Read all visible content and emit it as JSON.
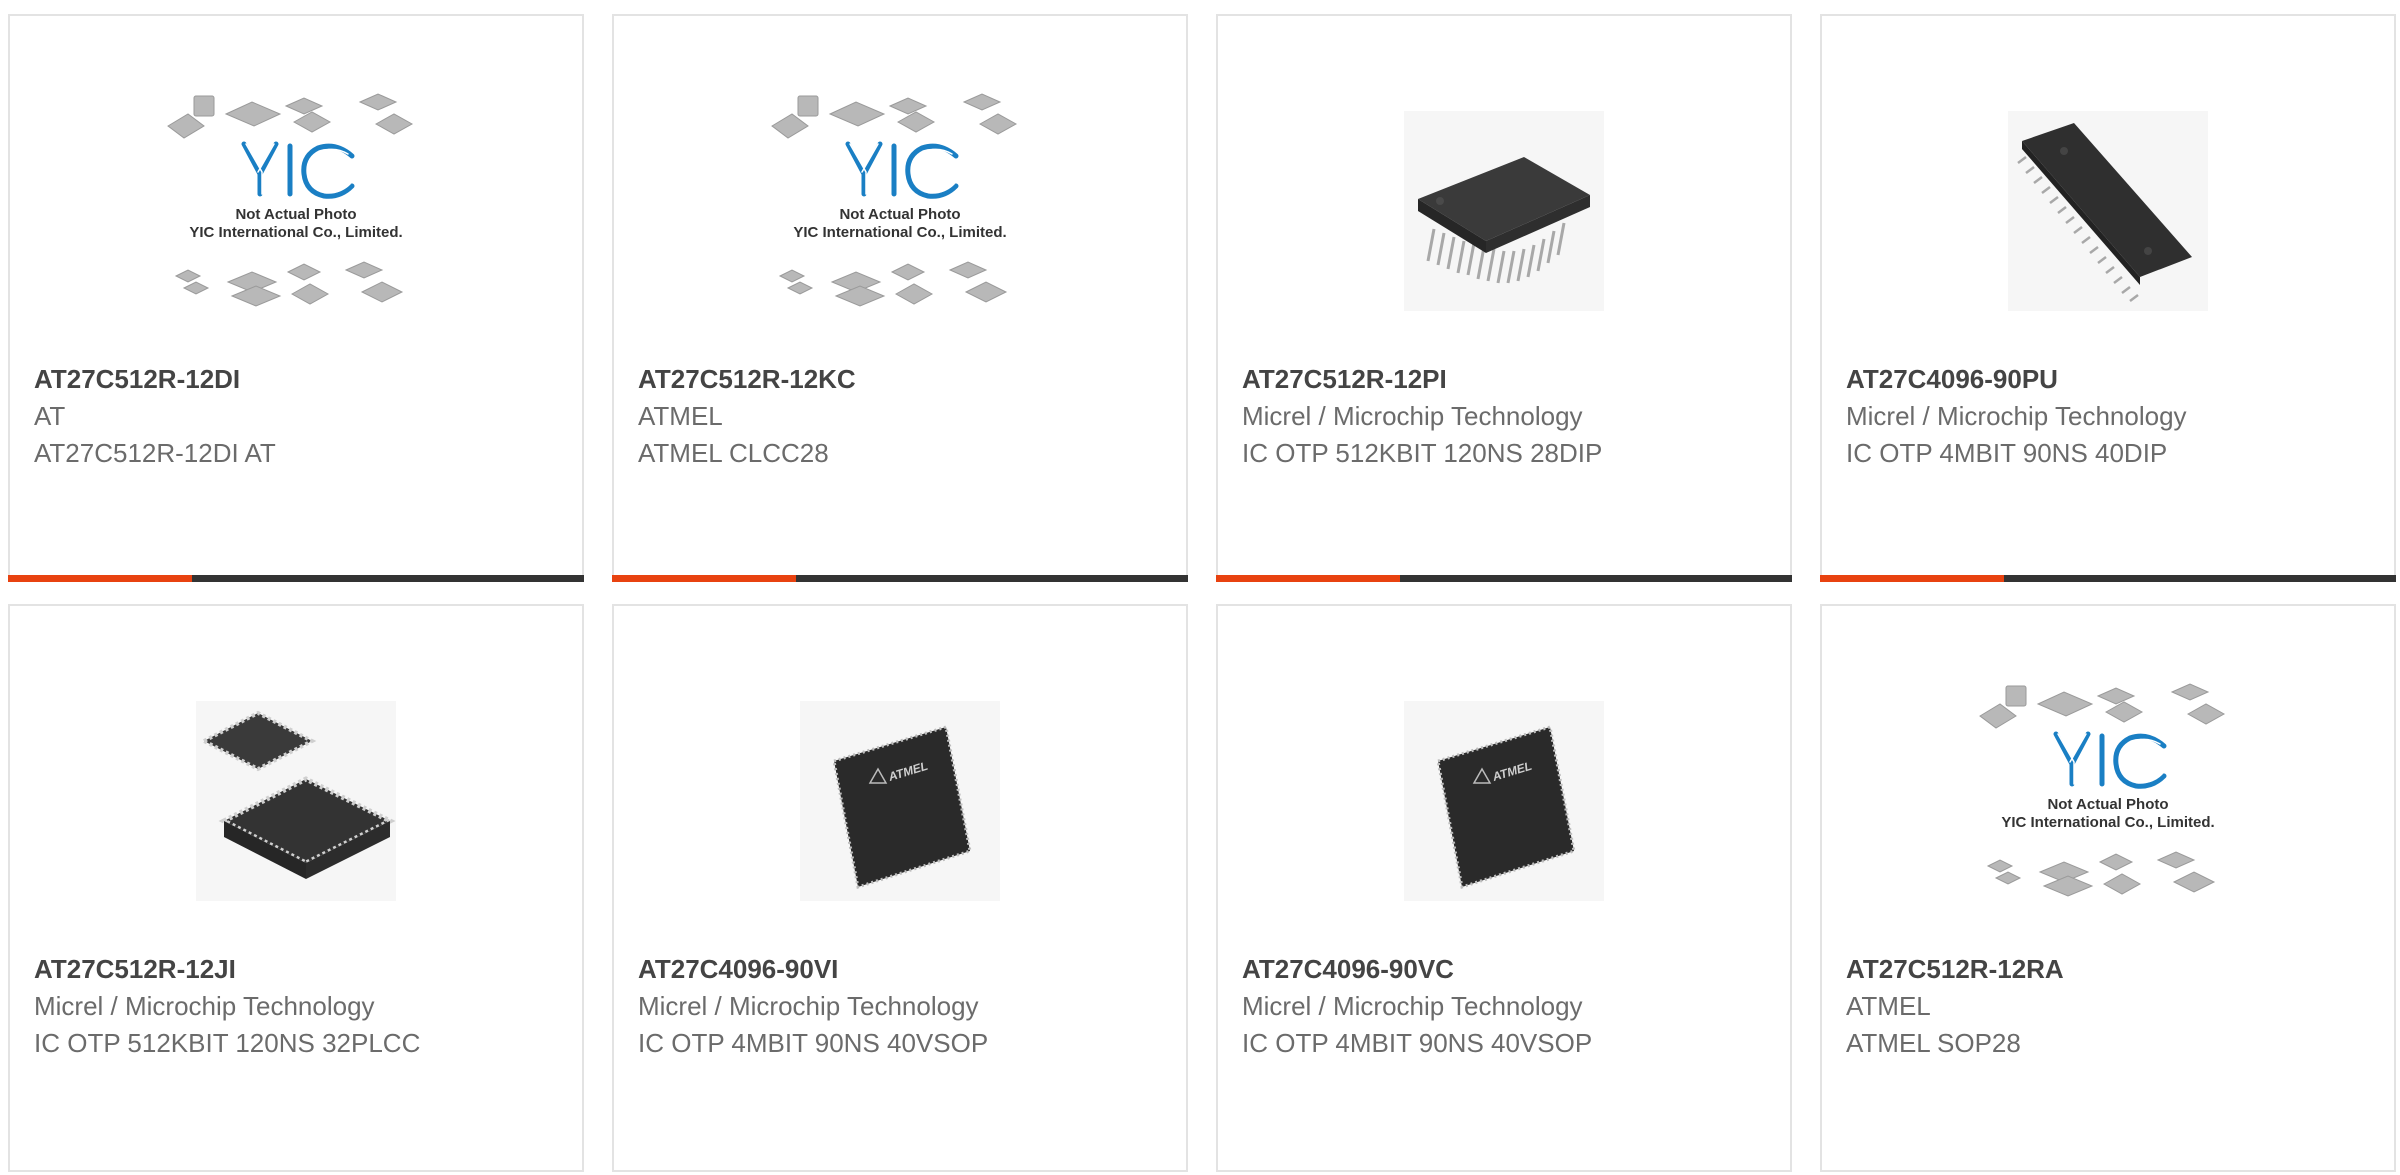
{
  "products": [
    {
      "part_number": "AT27C512R-12DI",
      "manufacturer": "AT",
      "description": "AT27C512R-12DI AT",
      "image": "yic-placeholder",
      "placeholder": {
        "logo": "YIC",
        "line1": "Not Actual Photo",
        "line2": "YIC International Co., Limited."
      },
      "has_accent_bar": true
    },
    {
      "part_number": "AT27C512R-12KC",
      "manufacturer": "ATMEL",
      "description": "ATMEL CLCC28",
      "image": "yic-placeholder",
      "placeholder": {
        "logo": "YIC",
        "line1": "Not Actual Photo",
        "line2": "YIC International Co., Limited."
      },
      "has_accent_bar": true
    },
    {
      "part_number": "AT27C512R-12PI",
      "manufacturer": "Micrel / Microchip Technology",
      "description": "IC OTP 512KBIT 120NS 28DIP",
      "image": "dip-chip",
      "has_accent_bar": true
    },
    {
      "part_number": "AT27C4096-90PU",
      "manufacturer": "Micrel / Microchip Technology",
      "description": "IC OTP 4MBIT 90NS 40DIP",
      "image": "dip40-chip",
      "has_accent_bar": true
    },
    {
      "part_number": "AT27C512R-12JI",
      "manufacturer": "Micrel / Microchip Technology",
      "description": "IC OTP 512KBIT 120NS 32PLCC",
      "image": "plcc-chip",
      "has_accent_bar": false
    },
    {
      "part_number": "AT27C4096-90VI",
      "manufacturer": "Micrel / Microchip Technology",
      "description": "IC OTP 4MBIT 90NS 40VSOP",
      "image": "vsop-chip",
      "chip_marking": "ATMEL",
      "has_accent_bar": false
    },
    {
      "part_number": "AT27C4096-90VC",
      "manufacturer": "Micrel / Microchip Technology",
      "description": "IC OTP 4MBIT 90NS 40VSOP",
      "image": "vsop-chip",
      "chip_marking": "ATMEL",
      "has_accent_bar": false
    },
    {
      "part_number": "AT27C512R-12RA",
      "manufacturer": "ATMEL",
      "description": "ATMEL SOP28",
      "image": "yic-placeholder",
      "placeholder": {
        "logo": "YIC",
        "line1": "Not Actual Photo",
        "line2": "YIC International Co., Limited."
      },
      "has_accent_bar": false
    }
  ],
  "colors": {
    "accent": "#e84210",
    "bar_dark": "#333333",
    "border": "#e3e3e3",
    "part_number_text": "#444444",
    "secondary_text": "#6b6b6b",
    "yic_logo_blue": "#1a7fc4"
  }
}
